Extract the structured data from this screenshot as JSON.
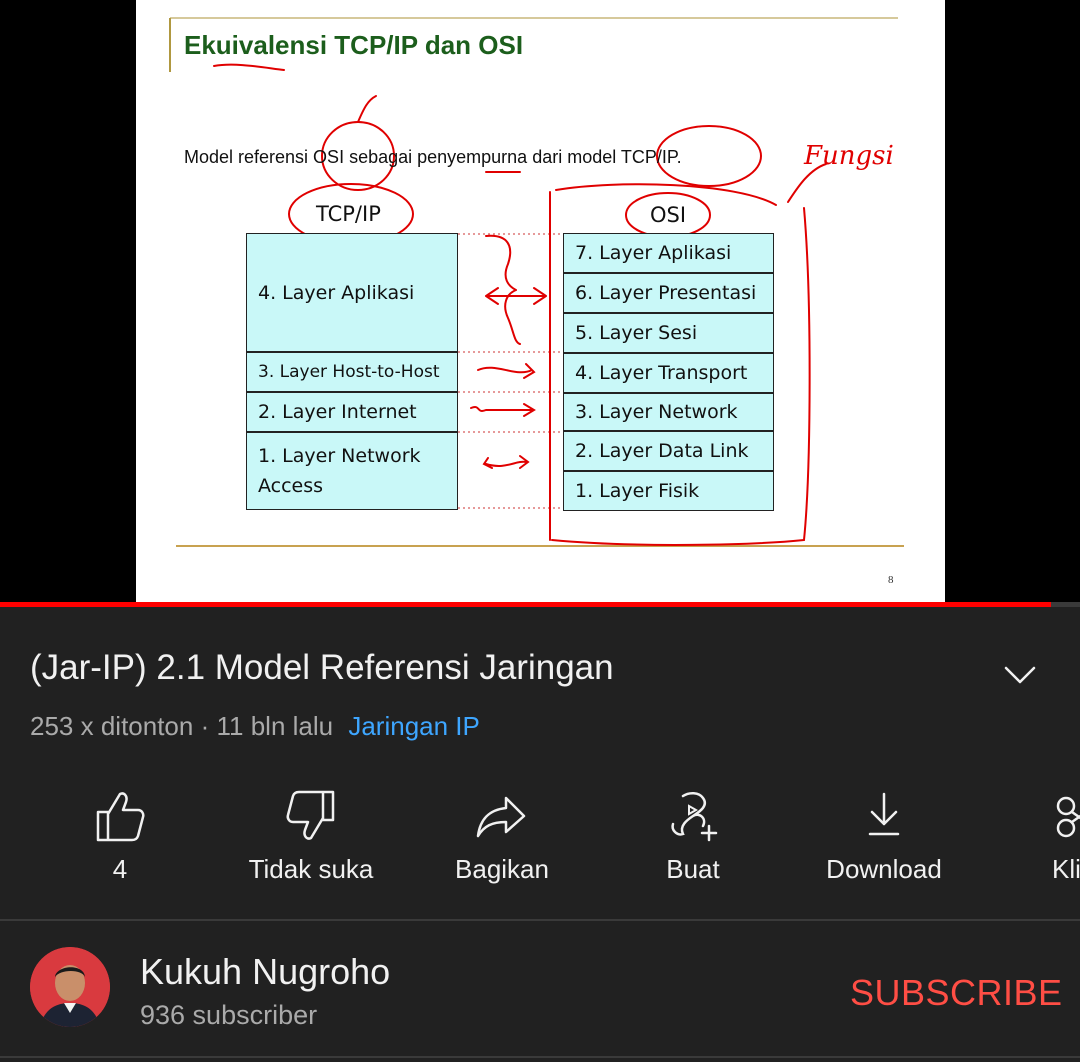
{
  "slide": {
    "title": "Ekuivalensi TCP/IP dan OSI",
    "subtitle": "Model referensi OSI sebagai penyempurna dari model TCP/IP.",
    "tcpip_header": "TCP/IP",
    "osi_header": "OSI",
    "tcpip_layers": [
      "4. Layer Aplikasi",
      "3. Layer Host-to-Host",
      "2. Layer Internet",
      "1. Layer Network Access"
    ],
    "osi_layers": [
      "7. Layer Aplikasi",
      "6. Layer Presentasi",
      "5. Layer Sesi",
      "4. Layer Transport",
      "3. Layer Network",
      "2. Layer Data Link",
      "1. Layer Fisik"
    ],
    "annotation": "Fungsi",
    "page_number": "8"
  },
  "player": {
    "progress": 0.973,
    "progress_color": "#ff0000"
  },
  "video": {
    "title": "(Jar-IP) 2.1 Model Referensi Jaringan",
    "views": "253 x ditonton",
    "separator": "·",
    "age": "11 bln lalu",
    "channel_link": "Jaringan IP"
  },
  "actions": [
    {
      "icon": "thumbs-up-icon",
      "label": "4"
    },
    {
      "icon": "thumbs-down-icon",
      "label": "Tidak suka"
    },
    {
      "icon": "share-icon",
      "label": "Bagikan"
    },
    {
      "icon": "create-icon",
      "label": "Buat"
    },
    {
      "icon": "download-icon",
      "label": "Download"
    },
    {
      "icon": "clip-icon",
      "label": "Kli"
    }
  ],
  "channel": {
    "name": "Kukuh Nugroho",
    "subscribers": "936 subscriber",
    "subscribe_label": "SUBSCRIBE"
  },
  "colors": {
    "background": "#212121",
    "accent_red": "#ff4e45",
    "link_blue": "#3ea6ff",
    "cell_fill": "#c9f8f8",
    "annotation_red": "#e00000"
  }
}
